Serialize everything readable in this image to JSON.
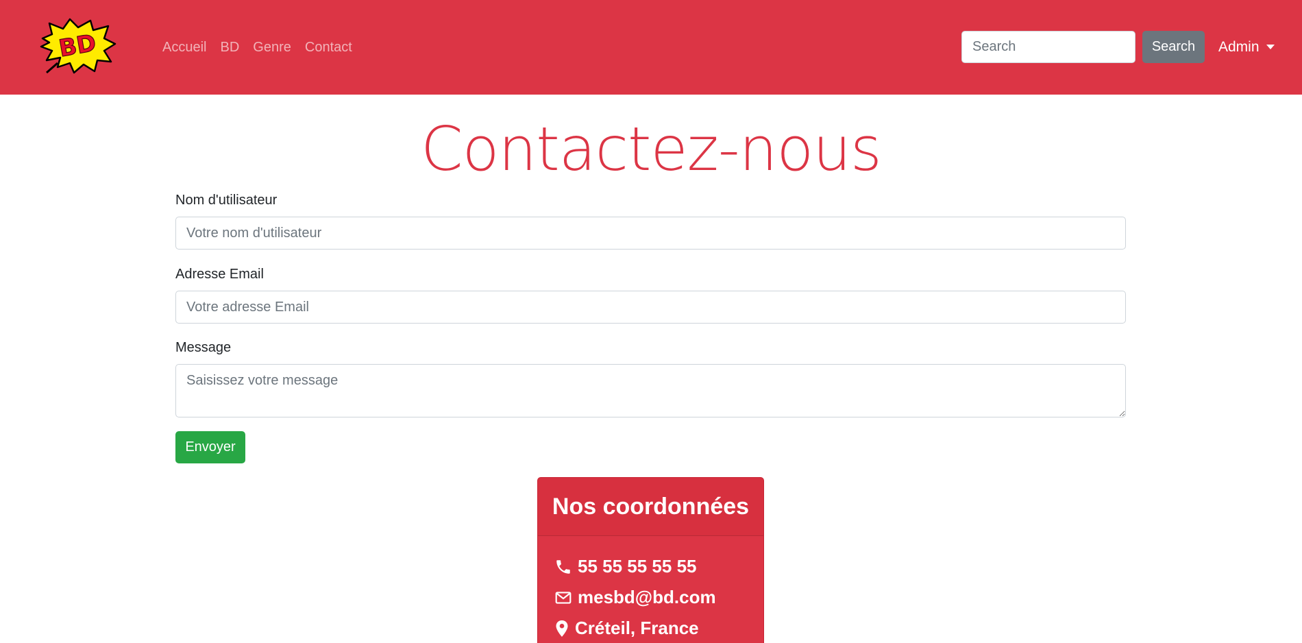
{
  "brand": {
    "logo_text": "BD"
  },
  "nav": {
    "links": [
      "Accueil",
      "BD",
      "Genre",
      "Contact"
    ],
    "search_placeholder": "Search",
    "search_button": "Search",
    "user_menu": "Admin"
  },
  "page": {
    "title": "Contactez-nous"
  },
  "form": {
    "username_label": "Nom d'utilisateur",
    "username_placeholder": "Votre nom d'utilisateur",
    "email_label": "Adresse Email",
    "email_placeholder": "Votre adresse Email",
    "message_label": "Message",
    "message_placeholder": "Saisissez votre message",
    "submit_label": "Envoyer"
  },
  "contact_card": {
    "title": "Nos coordonnées",
    "phone": "55 55 55 55 55",
    "email": "mesbd@bd.com",
    "location": "Créteil, France"
  },
  "colors": {
    "primary_red": "#dc3545",
    "success_green": "#28a745",
    "secondary_gray": "#6c757d",
    "logo_yellow": "#ffeb00"
  }
}
